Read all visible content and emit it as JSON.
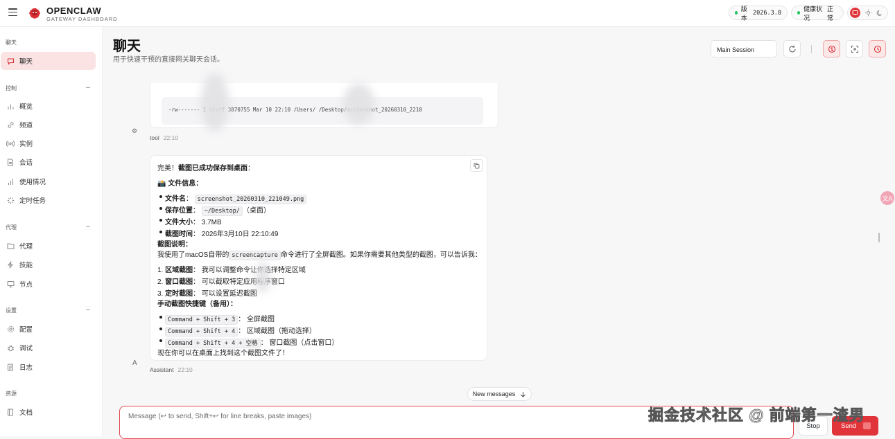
{
  "app": {
    "brand_title": "OPENCLAW",
    "brand_subtitle": "GATEWAY DASHBOARD",
    "version_label": "版本",
    "version_value": "2026.3.8",
    "health_label": "健康状况",
    "health_value": "正常",
    "accent_color": "#e0343a",
    "status_color": "#22c55e"
  },
  "sidebar": {
    "sections": [
      {
        "label": "聊天",
        "items": [
          {
            "label": "聊天",
            "icon": "chat-icon",
            "active": true
          }
        ]
      },
      {
        "label": "控制",
        "items": [
          {
            "label": "概览",
            "icon": "bar-chart-icon"
          },
          {
            "label": "频道",
            "icon": "link-icon"
          },
          {
            "label": "实例",
            "icon": "radio-icon"
          },
          {
            "label": "会话",
            "icon": "document-icon"
          },
          {
            "label": "使用情况",
            "icon": "chart-icon"
          },
          {
            "label": "定时任务",
            "icon": "spinner-icon"
          }
        ]
      },
      {
        "label": "代理",
        "items": [
          {
            "label": "代理",
            "icon": "folder-icon"
          },
          {
            "label": "技能",
            "icon": "lightning-icon"
          },
          {
            "label": "节点",
            "icon": "monitor-icon"
          }
        ]
      },
      {
        "label": "设置",
        "items": [
          {
            "label": "配置",
            "icon": "gear-icon"
          },
          {
            "label": "调试",
            "icon": "bug-icon"
          },
          {
            "label": "日志",
            "icon": "log-icon"
          }
        ]
      },
      {
        "label": "资源",
        "items": [
          {
            "label": "文档",
            "icon": "book-icon"
          }
        ]
      }
    ]
  },
  "header": {
    "title": "聊天",
    "subtitle": "用于快速干预的直接网关聊天会话。",
    "session_value": "Main Session"
  },
  "messages": {
    "tool_code_line": "-rw------- 1        staff  3870755 Mar 10 22:10 /Users/         /Desktop/screenshot_20260310_2210",
    "tool_sender": "tool",
    "tool_time": "22:10",
    "tool_avatar": "⚙",
    "assistant_avatar": "A",
    "assistant_sender": "Assistant",
    "assistant_time": "22:10",
    "intro_plain": "完美！",
    "intro_bold": "截图已成功保存到桌面",
    "intro_tail": "：",
    "file_info_emoji": "📸",
    "file_info_heading": "文件信息",
    "file_info_tail": "：",
    "file_items": [
      {
        "key": "文件名",
        "sep": "：",
        "code": "screenshot_20260310_221049.png",
        "text": ""
      },
      {
        "key": "保存位置",
        "sep": "：",
        "code": "~/Desktop/",
        "text": "（桌面）"
      },
      {
        "key": "文件大小",
        "sep": "：",
        "code": "",
        "text": "3.7MB"
      },
      {
        "key": "截图时间",
        "sep": "：",
        "code": "",
        "text": "2026年3月10日 22:10:49"
      }
    ],
    "explain_heading": "截图说明",
    "explain_tail": "：",
    "explain_pre": "我使用了macOS自带的",
    "explain_code": "screencapture",
    "explain_post": "命令进行了全屏截图。如果你需要其他类型的截图，可以告诉我：",
    "numbered": [
      {
        "num": "1.",
        "key": "区域截图",
        "sep": "：",
        "text": "我可以调整命令让你选择特定区域"
      },
      {
        "num": "2.",
        "key": "窗口截图",
        "sep": "：",
        "text": "可以截取特定应用程序窗口"
      },
      {
        "num": "3.",
        "key": "定时截图",
        "sep": "：",
        "text": "可以设置延迟截图"
      }
    ],
    "shortcut_heading": "手动截图快捷键（备用）",
    "shortcut_tail": "：",
    "shortcuts": [
      {
        "code": "Command + Shift + 3",
        "sep": "：",
        "text": "全屏截图"
      },
      {
        "code": "Command + Shift + 4",
        "sep": "：",
        "text": "区域截图（拖动选择）"
      },
      {
        "code": "Command + Shift + 4 + 空格",
        "sep": "：",
        "text": "窗口截图（点击窗口）"
      }
    ],
    "closing": "现在你可以在桌面上找到这个截图文件了！"
  },
  "composer": {
    "new_messages": "New messages",
    "placeholder": "Message (↩ to send, Shift+↩ for line breaks, paste images)",
    "stop_label": "Stop",
    "send_label": "Send"
  },
  "watermark": "掘金技术社区 @ 前端第一渣男",
  "translate_badge": "文A"
}
